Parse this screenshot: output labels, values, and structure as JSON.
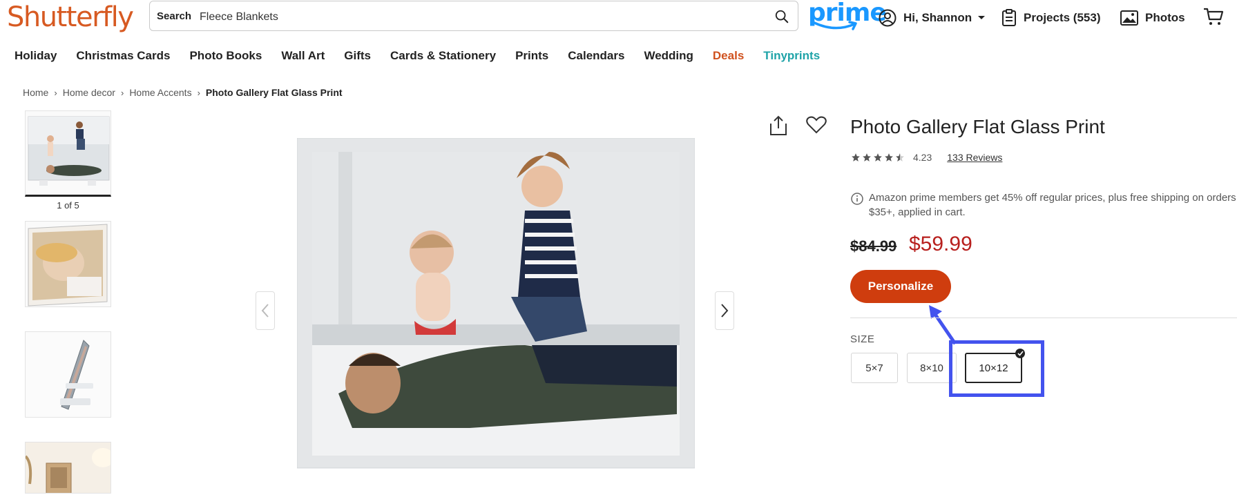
{
  "header": {
    "logo": "Shutterfly",
    "search_label": "Search",
    "search_value": "Fleece Blankets",
    "prime": "prime",
    "account": "Hi, Shannon",
    "projects": "Projects (553)",
    "photos": "Photos"
  },
  "nav": [
    "Holiday",
    "Christmas Cards",
    "Photo Books",
    "Wall Art",
    "Gifts",
    "Cards & Stationery",
    "Prints",
    "Calendars",
    "Wedding",
    "Deals",
    "Tinyprints"
  ],
  "breadcrumb": [
    "Home",
    "Home decor",
    "Home Accents",
    "Photo Gallery Flat Glass Print"
  ],
  "gallery": {
    "count_label": "1 of 5"
  },
  "product": {
    "title": "Photo Gallery Flat Glass Print",
    "rating_value": 4.23,
    "rating": "4.23",
    "reviews": "133 Reviews",
    "promo": "Amazon prime members get 45% off regular prices, plus free shipping on orders $35+, applied in cart.",
    "price_old": "$84.99",
    "price_new": "$59.99",
    "cta": "Personalize",
    "size_label": "SIZE",
    "sizes": [
      "5×7",
      "8×10",
      "10×12"
    ],
    "selected_size": "10×12"
  },
  "colors": {
    "brand": "#d75a22",
    "price": "#b8201e",
    "cta": "#cf3d0e",
    "highlight": "#4353ee",
    "prime": "#1a98ff"
  }
}
